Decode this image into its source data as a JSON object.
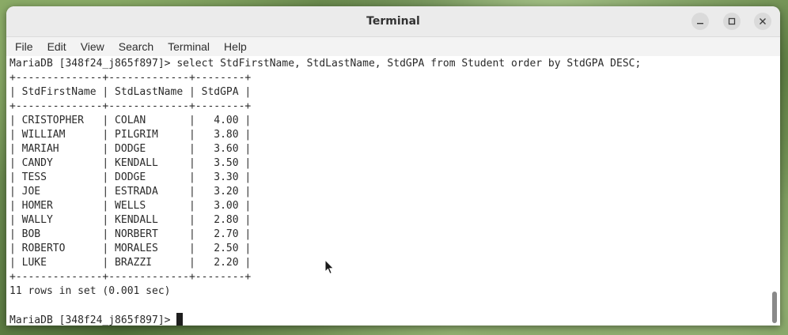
{
  "window": {
    "title": "Terminal"
  },
  "menu": [
    "File",
    "Edit",
    "View",
    "Search",
    "Terminal",
    "Help"
  ],
  "terminal": {
    "command_line": "MariaDB [348f24_j865f897]> select StdFirstName, StdLastName, StdGPA from Student order by StdGPA DESC;",
    "border_line": "+--------------+-------------+--------+",
    "columns": [
      "StdFirstName",
      "StdLastName",
      "StdGPA"
    ],
    "rows": [
      [
        "CRISTOPHER",
        "COLAN",
        "4.00"
      ],
      [
        "WILLIAM",
        "PILGRIM",
        "3.80"
      ],
      [
        "MARIAH",
        "DODGE",
        "3.60"
      ],
      [
        "CANDY",
        "KENDALL",
        "3.50"
      ],
      [
        "TESS",
        "DODGE",
        "3.30"
      ],
      [
        "JOE",
        "ESTRADA",
        "3.20"
      ],
      [
        "HOMER",
        "WELLS",
        "3.00"
      ],
      [
        "WALLY",
        "KENDALL",
        "2.80"
      ],
      [
        "BOB",
        "NORBERT",
        "2.70"
      ],
      [
        "ROBERTO",
        "MORALES",
        "2.50"
      ],
      [
        "LUKE",
        "BRAZZI",
        "2.20"
      ]
    ],
    "result_summary": "11 rows in set (0.001 sec)",
    "prompt": "MariaDB [348f24_j865f897]> "
  },
  "icons": {
    "minimize": "minimize-icon",
    "maximize": "maximize-icon",
    "close": "close-icon",
    "pointer": "mouse-pointer-icon"
  },
  "colors": {
    "titlebar": "#ebebeb",
    "terminal_bg": "#ffffff",
    "terminal_fg": "#2a2a2a"
  }
}
